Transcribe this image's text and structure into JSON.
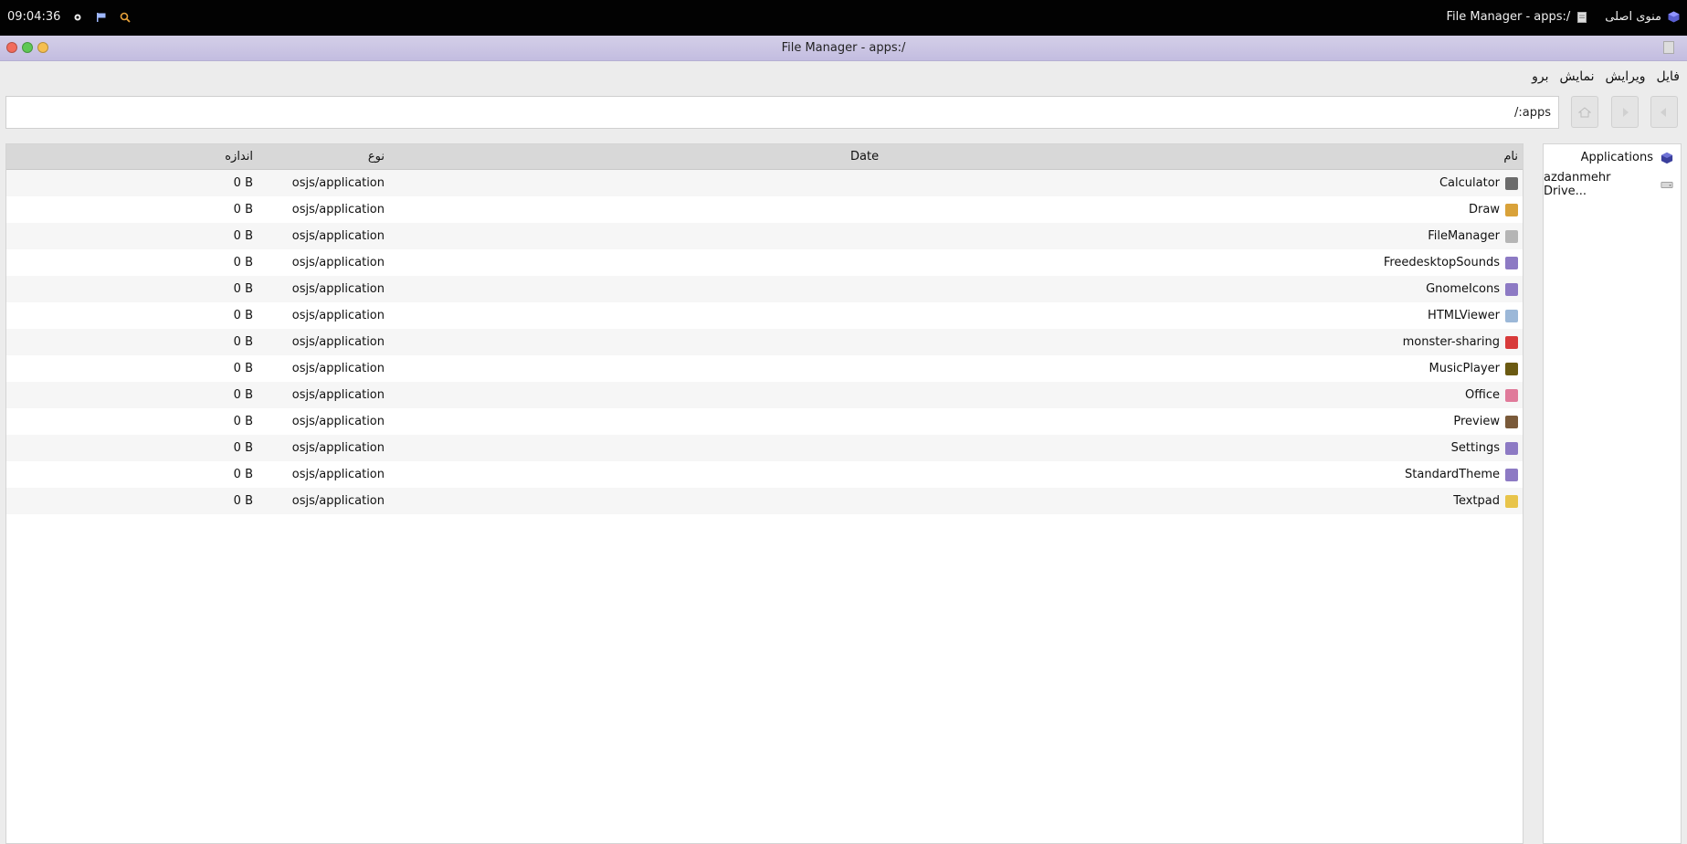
{
  "topbar": {
    "clock": "09:04:36",
    "left_icons": [
      "settings-icon",
      "flag-icon",
      "search-icon"
    ],
    "menu_label": "منوی اصلی",
    "active_window_label": "File Manager - apps:/"
  },
  "window": {
    "title": "File Manager - apps:/",
    "menu": [
      "فایل",
      "ویرایش",
      "نمایش",
      "برو"
    ],
    "path": "apps:/"
  },
  "list": {
    "headers": {
      "name": "نام",
      "date": "Date",
      "type": "نوع",
      "size": "اندازه"
    },
    "rows": [
      {
        "name": "Calculator",
        "type": "osjs/application",
        "size": "0 B",
        "icon": "calculator-icon",
        "color": "#6b6b6b"
      },
      {
        "name": "Draw",
        "type": "osjs/application",
        "size": "0 B",
        "icon": "draw-icon",
        "color": "#d9a23a"
      },
      {
        "name": "FileManager",
        "type": "osjs/application",
        "size": "0 B",
        "icon": "file-manager-icon",
        "color": "#b5b5b5"
      },
      {
        "name": "FreedesktopSounds",
        "type": "osjs/application",
        "size": "0 B",
        "icon": "package-icon",
        "color": "#8d7ac4"
      },
      {
        "name": "GnomeIcons",
        "type": "osjs/application",
        "size": "0 B",
        "icon": "package-icon",
        "color": "#8d7ac4"
      },
      {
        "name": "HTMLViewer",
        "type": "osjs/application",
        "size": "0 B",
        "icon": "web-icon",
        "color": "#9cb8d8"
      },
      {
        "name": "monster-sharing",
        "type": "osjs/application",
        "size": "0 B",
        "icon": "share-icon",
        "color": "#d83a3a"
      },
      {
        "name": "MusicPlayer",
        "type": "osjs/application",
        "size": "0 B",
        "icon": "music-icon",
        "color": "#6b5a12"
      },
      {
        "name": "Office",
        "type": "osjs/application",
        "size": "0 B",
        "icon": "office-icon",
        "color": "#e07a9a"
      },
      {
        "name": "Preview",
        "type": "osjs/application",
        "size": "0 B",
        "icon": "image-icon",
        "color": "#7a5a3a"
      },
      {
        "name": "Settings",
        "type": "osjs/application",
        "size": "0 B",
        "icon": "package-icon",
        "color": "#8d7ac4"
      },
      {
        "name": "StandardTheme",
        "type": "osjs/application",
        "size": "0 B",
        "icon": "package-icon",
        "color": "#8d7ac4"
      },
      {
        "name": "Textpad",
        "type": "osjs/application",
        "size": "0 B",
        "icon": "textpad-icon",
        "color": "#e8c44a"
      }
    ]
  },
  "sidebar": {
    "items": [
      {
        "label": "Applications",
        "icon": "applications-icon",
        "color": "#3b3f9c"
      },
      {
        "label": "azdanmehr Drive...",
        "icon": "drive-icon",
        "color": "#9a9a9a"
      }
    ]
  },
  "colors": {
    "titlebar": "#c9c4e3",
    "close": "#f26b5c",
    "minimize": "#5ec854",
    "maximize": "#f5bf4f"
  }
}
